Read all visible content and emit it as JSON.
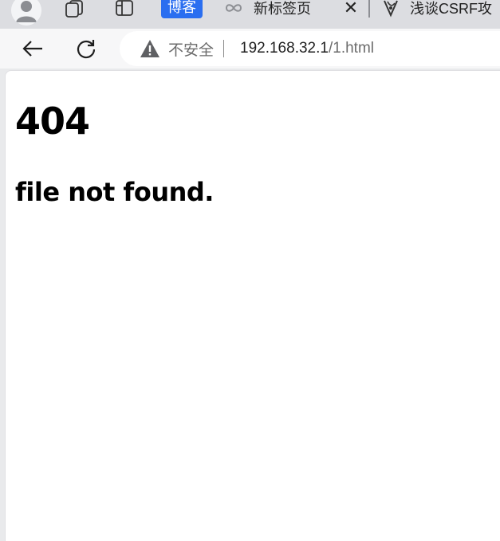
{
  "browser": {
    "tabs": {
      "blog_badge": "博客",
      "new_tab_title": "新标签页",
      "close_symbol": "✕",
      "csrf_tab_title": "浅谈CSRF攻"
    },
    "address_bar": {
      "security_label": "不安全",
      "url_host": "192.168.32.1",
      "url_path": "/1.html"
    },
    "icons": {
      "profile": "avatar-icon",
      "workspaces": "workspaces-icon",
      "tab_actions": "tab-actions-icon",
      "new_tab": "infinity-icon",
      "back": "back-arrow-icon",
      "reload": "reload-icon",
      "warning": "warning-triangle-icon",
      "csrf_favicon": "site-favicon-icon"
    },
    "colors": {
      "badge_bg": "#2a6ef0",
      "tabbar_bg": "#dcdde1",
      "toolbar_bg": "#f7f7f8"
    }
  },
  "page": {
    "heading": "404",
    "message": "file not found."
  }
}
